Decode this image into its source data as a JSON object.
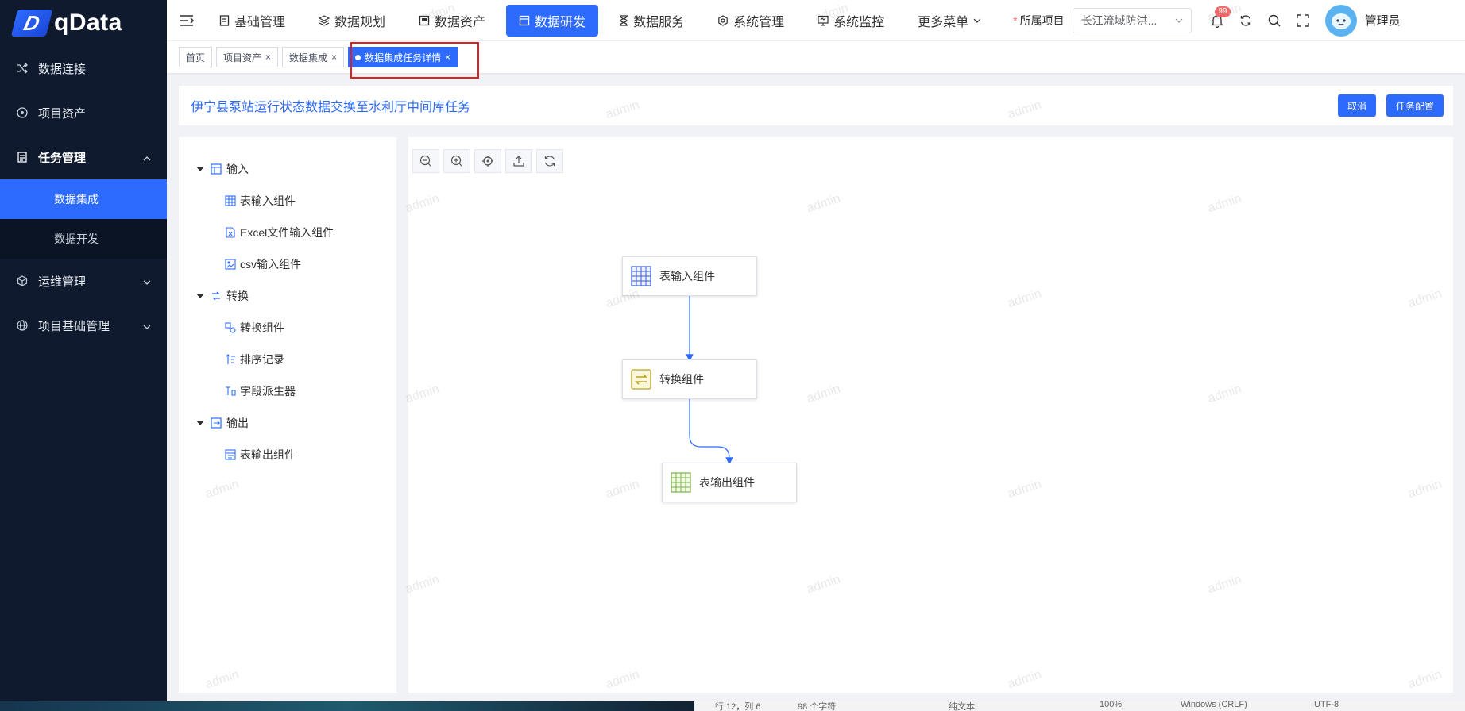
{
  "brand": {
    "logo_letter": "D",
    "name": "qData"
  },
  "sidebar": {
    "items": [
      {
        "label": "数据连接",
        "icon": "shuffle-icon"
      },
      {
        "label": "项目资产",
        "icon": "asset-icon"
      },
      {
        "label": "任务管理",
        "icon": "task-icon",
        "open": true,
        "children": [
          {
            "label": "数据集成",
            "active": true
          },
          {
            "label": "数据开发"
          }
        ]
      },
      {
        "label": "运维管理",
        "icon": "cube-icon"
      },
      {
        "label": "项目基础管理",
        "icon": "globe-icon"
      }
    ]
  },
  "topnav": {
    "items": [
      {
        "label": "基础管理",
        "icon": "doc-icon"
      },
      {
        "label": "数据规划",
        "icon": "layers-icon"
      },
      {
        "label": "数据资产",
        "icon": "asset-icon"
      },
      {
        "label": "数据研发",
        "icon": "window-icon",
        "active": true
      },
      {
        "label": "数据服务",
        "icon": "hourglass-icon"
      },
      {
        "label": "系统管理",
        "icon": "settings-icon"
      },
      {
        "label": "系统监控",
        "icon": "monitor-icon"
      },
      {
        "label": "更多菜单",
        "icon": "chevron-down-icon"
      }
    ],
    "project_label": "所属项目",
    "project_required": "*",
    "project_value": "长江流域防洪...",
    "notification_count": "99",
    "user_name": "管理员"
  },
  "tabs": [
    {
      "label": "首页",
      "closable": false
    },
    {
      "label": "项目资产",
      "closable": true
    },
    {
      "label": "数据集成",
      "closable": true
    },
    {
      "label": "数据集成任务详情",
      "closable": true,
      "active": true
    }
  ],
  "tab_close_glyph": "×",
  "header": {
    "title": "伊宁县泵站运行状态数据交换至水利厅中间库任务",
    "cancel_label": "取消",
    "config_label": "任务配置"
  },
  "tree": {
    "groups": [
      {
        "label": "输入",
        "items": [
          "表输入组件",
          "Excel文件输入组件",
          "csv输入组件"
        ]
      },
      {
        "label": "转换",
        "items": [
          "转换组件",
          "排序记录",
          "字段派生器"
        ]
      },
      {
        "label": "输出",
        "items": [
          "表输出组件"
        ]
      }
    ]
  },
  "canvas": {
    "toolbar": [
      "zoom-out-icon",
      "zoom-in-icon",
      "locate-icon",
      "export-icon",
      "refresh-icon"
    ],
    "nodes": [
      {
        "label": "表输入组件",
        "icon": "table-icon"
      },
      {
        "label": "转换组件",
        "icon": "convert-icon"
      },
      {
        "label": "表输出组件",
        "icon": "table-icon"
      }
    ]
  },
  "watermark_text": "admin",
  "colors": {
    "primary": "#2d6bff",
    "sidebar_bg": "#0f1a2e",
    "highlight_border": "#e02020"
  },
  "status_bar": [
    "行 12，列 6",
    "98 个字符",
    "纯文本",
    "100%",
    "Windows (CRLF)",
    "UTF-8"
  ]
}
